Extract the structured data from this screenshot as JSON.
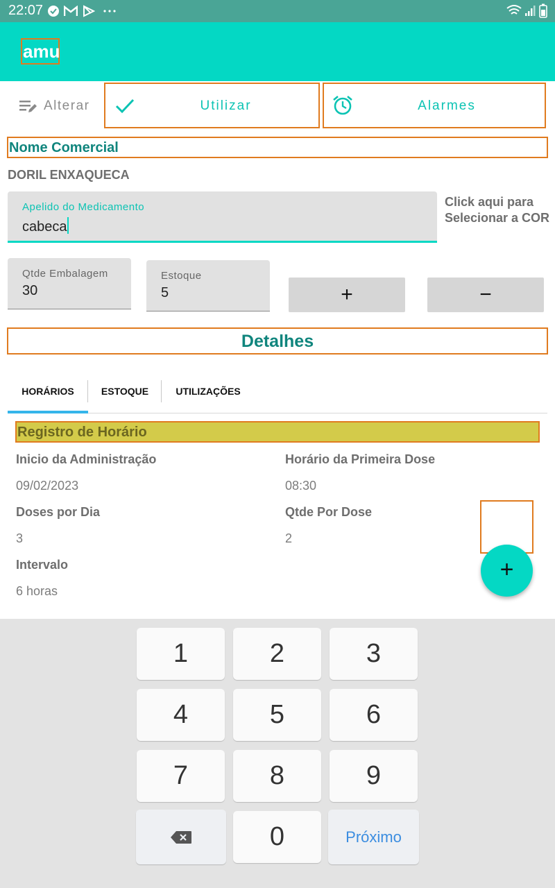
{
  "status_bar": {
    "time": "22:07",
    "icons": [
      "check-circle-icon",
      "gmail-icon",
      "play-store-icon",
      "more-dots-icon",
      "wifi-icon",
      "signal-icon",
      "battery-icon"
    ]
  },
  "app_bar": {
    "title": "amu"
  },
  "toolbar": {
    "alterar_label": "Alterar",
    "utilizar_label": "Utilizar",
    "alarmes_label": "Alarmes"
  },
  "nome_comercial": {
    "heading": "Nome Comercial",
    "value": "DORIL ENXAQUECA"
  },
  "apelido": {
    "label": "Apelido do Medicamento",
    "value": "cabeca"
  },
  "cor_hint": {
    "line1": "Click aqui para",
    "line2": "Selecionar a COR"
  },
  "qtde_embalagem": {
    "label": "Qtde Embalagem",
    "value": "30"
  },
  "estoque": {
    "label": "Estoque",
    "value": "5"
  },
  "stepper": {
    "plus": "+",
    "minus": "−"
  },
  "detalhes": {
    "heading": "Detalhes"
  },
  "tabs": [
    {
      "label": "HORÁRIOS",
      "active": true
    },
    {
      "label": "ESTOQUE",
      "active": false
    },
    {
      "label": "UTILIZAÇÕES",
      "active": false
    }
  ],
  "registro": {
    "heading": "Registro de Horário",
    "inicio_label": "Inicio da Administração",
    "inicio_value": "09/02/2023",
    "primeira_label": "Horário da Primeira Dose",
    "primeira_value": "08:30",
    "doses_label": "Doses por Dia",
    "doses_value": "3",
    "qtde_dose_label": "Qtde Por Dose",
    "qtde_dose_value": "2",
    "intervalo_label": "Intervalo",
    "intervalo_value": "6 horas"
  },
  "fab": {
    "label": "+"
  },
  "keyboard": {
    "keys": [
      "1",
      "2",
      "3",
      "4",
      "5",
      "6",
      "7",
      "8",
      "9",
      "0"
    ],
    "next_label": "Próximo"
  },
  "colors": {
    "accent": "#04d8c4",
    "status_bar": "#4aa596",
    "heading_teal": "#10857d",
    "highlight": "#d3cb4a",
    "outline": "#e07b1f"
  }
}
